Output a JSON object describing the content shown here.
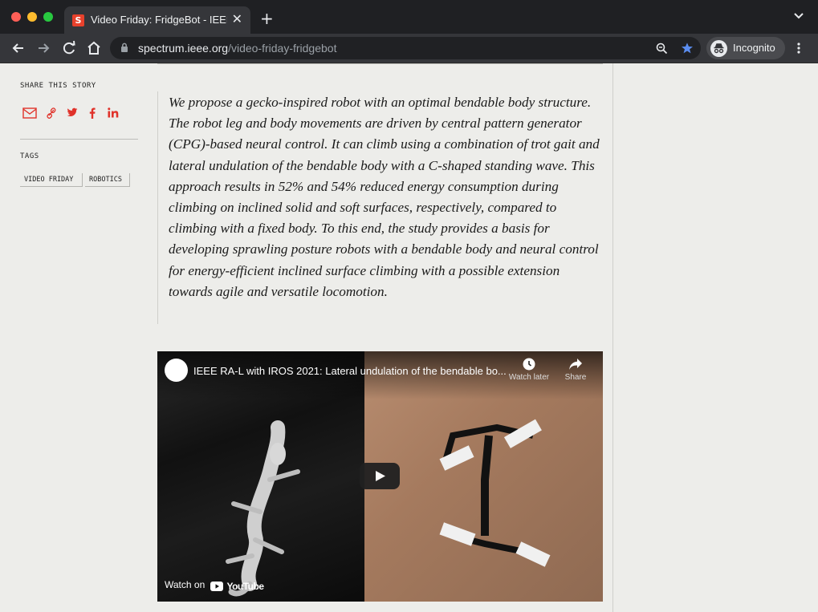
{
  "browser": {
    "tab_title": "Video Friday: FridgeBot - IEEE Spectrum",
    "tab_favicon_letter": "S",
    "tab_close": "✕",
    "new_tab": "+",
    "url_domain": "spectrum.ieee.org",
    "url_path": "/video-friday-fridgebot",
    "incognito_label": "Incognito",
    "colors": {
      "favicon": "#e8412c",
      "bookmark_star": "#5b8def"
    }
  },
  "sidebar": {
    "share_label": "SHARE THIS STORY",
    "share_icons": [
      "email-icon",
      "link-icon",
      "twitter-icon",
      "facebook-icon",
      "linkedin-icon"
    ],
    "tags_label": "TAGS",
    "tags": [
      "VIDEO FRIDAY",
      "ROBOTICS"
    ],
    "accent_color": "#e0322a"
  },
  "article": {
    "quote": "We propose a gecko-inspired robot with an optimal bendable body structure. The robot leg and body movements are driven by central pattern generator (CPG)-based neural control. It can climb using a combination of trot gait and lateral undulation of the bendable body with a C-shaped standing wave. This approach results in 52% and 54% reduced energy consumption during climbing on inclined solid and soft surfaces, respectively, compared to climbing with a fixed body. To this end, the study provides a basis for developing sprawling posture robots with a bendable body and neural control for energy-efficient inclined surface climbing with a possible extension towards agile and versatile locomotion."
  },
  "video": {
    "title": "IEEE RA-L with IROS 2021: Lateral undulation of the bendable bo...",
    "watch_later": "Watch later",
    "share": "Share",
    "watch_on": "Watch on",
    "youtube": "YouTube"
  }
}
